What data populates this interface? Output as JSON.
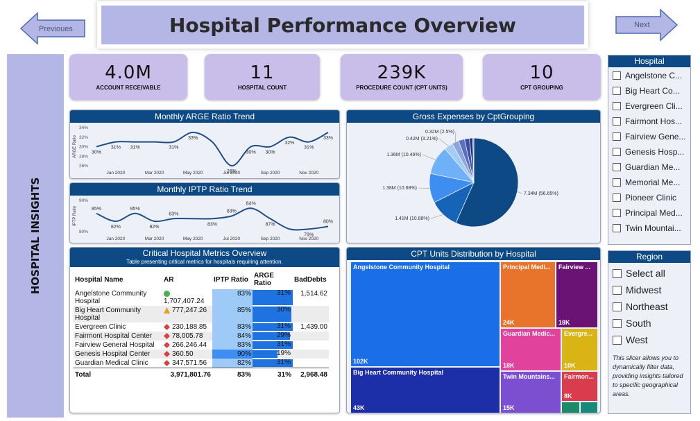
{
  "nav": {
    "previous_label": "Previoues",
    "next_label": "Next"
  },
  "title": "Hospital Performance Overview",
  "sidebar_label": "HOSPITAL INSIGHTS",
  "kpis": [
    {
      "value": "4.0M",
      "label": "ACCOUNT RECEIVABLE"
    },
    {
      "value": "11",
      "label": "HOSPITAL COUNT"
    },
    {
      "value": "239K",
      "label": "PROCEDURE COUNT (CPT UNITS)"
    },
    {
      "value": "10",
      "label": "CPT GROUPING"
    }
  ],
  "hospital_slicer": {
    "title": "Hospital",
    "items": [
      "Angelstone C...",
      "Big Heart Co...",
      "Evergreen Cli...",
      "Fairmont Hos...",
      "Fairview Gene...",
      "Genesis Hosp...",
      "Guardian Me...",
      "Memorial Me...",
      "Pioneer Clinic",
      "Principal Med...",
      "Twin Mountai..."
    ]
  },
  "region_slicer": {
    "title": "Region",
    "items": [
      "Select all",
      "Midwest",
      "Northeast",
      "South",
      "West"
    ],
    "note": "This slicer allows you to dynamically filter data, providing insights tailored to specific geographical areas."
  },
  "chart_data": [
    {
      "type": "line",
      "title": "Monthly ARGE Ratio Trend",
      "ylabel": "ARGE Ratio",
      "ylim": [
        26,
        34
      ],
      "yticks": [
        "34%",
        "32%",
        "30%",
        "28%",
        "26%"
      ],
      "xticks": [
        "Jan 2020",
        "Mar 2020",
        "May 2020",
        "Jul 2020",
        "Sep 2020",
        "Nov 2020"
      ],
      "values": [
        30,
        31,
        31,
        31,
        31,
        33,
        31,
        26,
        30,
        30,
        32,
        31,
        33
      ],
      "data_labels": [
        "30%",
        "31%",
        "31%",
        "31%",
        "33%",
        "26%",
        "30%",
        "30%",
        "32%",
        "31%",
        "33%"
      ]
    },
    {
      "type": "line",
      "title": "Monthly IPTP Ratio Trend",
      "ylabel": "IPTP Ratio",
      "ylim": [
        78,
        90
      ],
      "yticks": [
        "90%",
        "80%"
      ],
      "xticks": [
        "Jan 2020",
        "Mar 2020",
        "May 2020",
        "Jul 2020",
        "Sep 2020",
        "Nov 2020"
      ],
      "values": [
        85,
        82,
        85,
        82,
        83,
        83,
        83,
        84,
        87,
        83,
        79,
        79,
        80
      ],
      "data_labels": [
        "85%",
        "82%",
        "85%",
        "82%",
        "83%",
        "83%",
        "83%",
        "84%",
        "87%",
        "79%",
        "80%"
      ]
    },
    {
      "type": "pie",
      "title": "Gross Expenses by CptGrouping",
      "slices": [
        {
          "label": "7.34M (56.65%)",
          "value": 56.65,
          "color": "#0d4a85"
        },
        {
          "label": "1.41M (10.88%)",
          "value": 10.88,
          "color": "#1664b8"
        },
        {
          "label": "1.38M (10.68%)",
          "value": 10.68,
          "color": "#3d8ef0"
        },
        {
          "label": "1.36M (10.46%)",
          "value": 10.46,
          "color": "#6fb1f8"
        },
        {
          "label": "0.42M (3.21%)",
          "value": 3.21,
          "color": "#a3cdf6"
        },
        {
          "label": "0.32M (2.5%)",
          "value": 2.5,
          "color": "#8fa4d8"
        },
        {
          "label": "",
          "value": 2.2,
          "color": "#5a6fc0"
        },
        {
          "label": "",
          "value": 1.8,
          "color": "#3a4fa6"
        },
        {
          "label": "",
          "value": 1.2,
          "color": "#1f2f80"
        },
        {
          "label": "",
          "value": 0.4,
          "color": "#a0a0c0"
        }
      ]
    },
    {
      "type": "treemap",
      "title": "CPT Units Distribution by Hospital",
      "cells": [
        {
          "name": "Angelstone Community Hospital",
          "value": "102K",
          "color": "#1a6ee8"
        },
        {
          "name": "Big Heart Community Hospital",
          "value": "43K",
          "color": "#1c2ea8"
        },
        {
          "name": "Principal Medi...",
          "value": "24K",
          "color": "#e8742c"
        },
        {
          "name": "Fairview ...",
          "value": "18K",
          "color": "#6b1275"
        },
        {
          "name": "Guardian Medic...",
          "value": "18K",
          "color": "#e0429c"
        },
        {
          "name": "Evergre...",
          "value": "10K",
          "color": "#d8b414"
        },
        {
          "name": "Twin Mountains...",
          "value": "15K",
          "color": "#7b4fd0"
        },
        {
          "name": "Fairmon...",
          "value": "8K",
          "color": "#d93c4c"
        },
        {
          "name": "",
          "value": "",
          "color": "#1f8a6a"
        },
        {
          "name": "",
          "value": "",
          "color": "#178a7a"
        }
      ]
    }
  ],
  "metrics_table": {
    "title": "Critical Hospital Metrics Overview",
    "subtitle": "Table presenting critical metrics for hospitals requiring attention.",
    "columns": [
      "Hospital Name",
      "AR",
      "IPTP Ratio",
      "ARGE Ratio",
      "BadDebts"
    ],
    "rows": [
      {
        "name": "Angelstone Community Hospital",
        "indicator": "green",
        "ar": "1,707,407.24",
        "iptp": "83%",
        "arge": "31%",
        "arge_v": 31,
        "baddebts": "1,514.62"
      },
      {
        "name": "Big Heart Community Hospital",
        "indicator": "yellow",
        "ar": "777,247.26",
        "iptp": "85%",
        "arge": "30%",
        "arge_v": 30,
        "baddebts": ""
      },
      {
        "name": "Evergreen Clinic",
        "indicator": "red",
        "ar": "230,188.85",
        "iptp": "83%",
        "arge": "31%",
        "arge_v": 31,
        "baddebts": "1,439.00"
      },
      {
        "name": "Fairmont Hospital Center",
        "indicator": "red",
        "ar": "78,005.78",
        "iptp": "84%",
        "arge": "29%",
        "arge_v": 29,
        "baddebts": ""
      },
      {
        "name": "Fairview General Hospital",
        "indicator": "red",
        "ar": "266,246.44",
        "iptp": "83%",
        "arge": "31%",
        "arge_v": 31,
        "baddebts": ""
      },
      {
        "name": "Genesis Hospital Center",
        "indicator": "red",
        "ar": "360.50",
        "iptp": "90%",
        "arge": "19%",
        "arge_v": 19,
        "baddebts": ""
      },
      {
        "name": "Guardian Medical Clinic",
        "indicator": "red",
        "ar": "347,571.56",
        "iptp": "82%",
        "arge": "31%",
        "arge_v": 31,
        "baddebts": ""
      }
    ],
    "total": {
      "name": "Total",
      "ar": "3,971,801.76",
      "iptp": "83%",
      "arge": "31%",
      "baddebts": "2,968.48"
    }
  }
}
